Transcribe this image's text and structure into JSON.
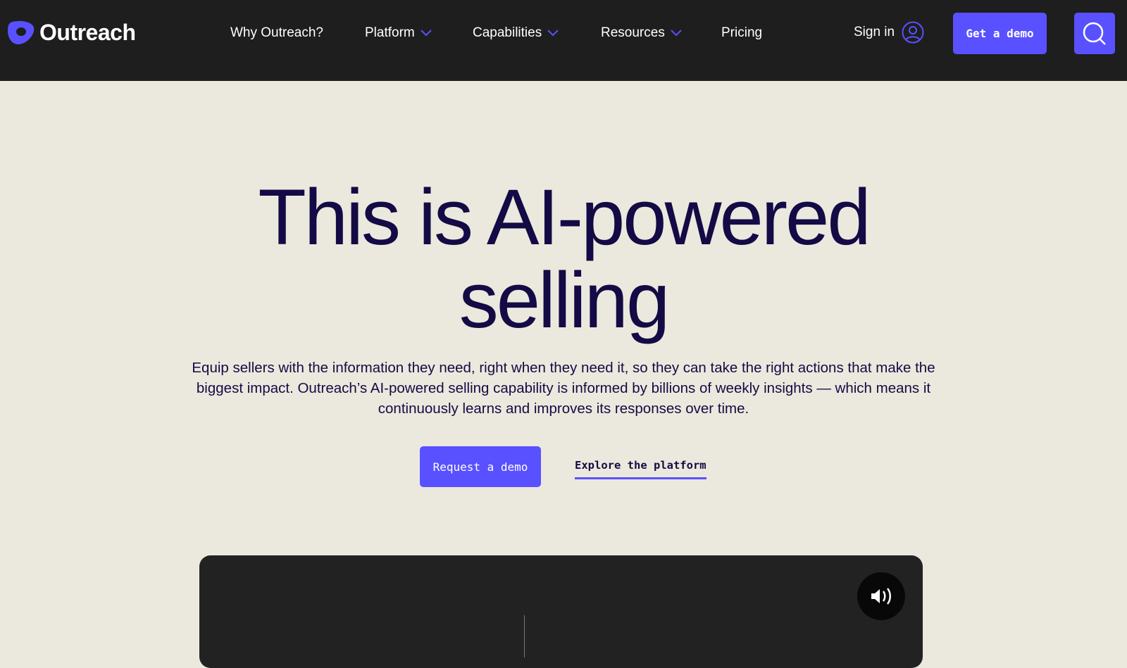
{
  "nav": {
    "brand": "Outreach",
    "items": [
      {
        "label": "Why Outreach?",
        "dropdown": false
      },
      {
        "label": "Platform",
        "dropdown": true
      },
      {
        "label": "Capabilities",
        "dropdown": true
      },
      {
        "label": "Resources",
        "dropdown": true
      },
      {
        "label": "Pricing",
        "dropdown": false
      }
    ],
    "sign_in": "Sign in",
    "get_demo": "Get a demo"
  },
  "hero": {
    "title_line1": "This is AI-powered",
    "title_line2": "selling",
    "subtitle": "Equip sellers with the information they need, right when they need it, so they can take the right actions that make the biggest impact. Outreach’s AI-powered selling capability is informed by billions of weekly insights — which means it continuously learns and improves its responses over time.",
    "request_demo": "Request a demo",
    "explore": "Explore the platform"
  },
  "colors": {
    "accent": "#5951ff",
    "nav_bg": "#1e1e1e",
    "page_bg": "#ebe9dd",
    "heading": "#140a45"
  }
}
